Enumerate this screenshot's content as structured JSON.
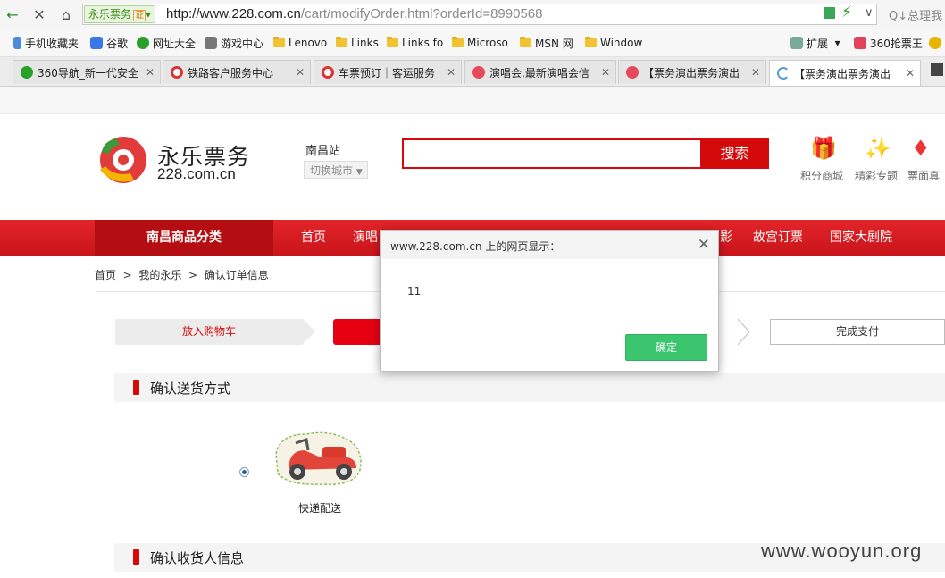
{
  "browser": {
    "site_badge": "永乐票务",
    "site_cert": "证",
    "url_host": "http://www.228.com.cn",
    "url_path": "/cart/modifyOrder.html?orderId=8990568",
    "search_hint": "Q↓总理我",
    "bookmarks": [
      "手机收藏夹",
      "谷歌",
      "网址大全",
      "游戏中心",
      "Lenovo",
      "Links",
      "Links fo",
      "Microso",
      "MSN 网",
      "Window"
    ],
    "extensions_label": "扩展",
    "extension_item": "360抢票王",
    "tabs": [
      {
        "title": "360导航_新一代安全",
        "active": false
      },
      {
        "title": "铁路客户服务中心",
        "active": false
      },
      {
        "title": "车票预订｜客运服务",
        "active": false
      },
      {
        "title": "演唱会,最新演唱会信",
        "active": false
      },
      {
        "title": "【票务演出票务演出",
        "active": false
      },
      {
        "title": "【票务演出票务演出",
        "active": true
      }
    ]
  },
  "header": {
    "logo_cn": "永乐票务",
    "logo_en": "228.com.cn",
    "city": "南昌站",
    "switch_city": "切换城市",
    "search_button": "搜索",
    "tools": [
      "积分商城",
      "精彩专题",
      "票面真"
    ]
  },
  "nav": {
    "category": "南昌商品分类",
    "items": [
      "首页",
      "演唱",
      "影",
      "故宫订票",
      "国家大剧院"
    ]
  },
  "breadcrumb": [
    "首页",
    "我的永乐",
    "确认订单信息"
  ],
  "steps": {
    "step1": "放入购物车",
    "step4": "完成支付"
  },
  "sections": {
    "delivery_title": "确认送货方式",
    "delivery_option": "快递配送",
    "receiver_title": "确认收货人信息"
  },
  "dialog": {
    "title": "www.228.com.cn 上的网页显示：",
    "message": "11",
    "ok_label": "确定"
  },
  "watermark": "www.wooyun.org",
  "colors": {
    "brand_red": "#d40a0a",
    "ok_green": "#3ac56e"
  }
}
